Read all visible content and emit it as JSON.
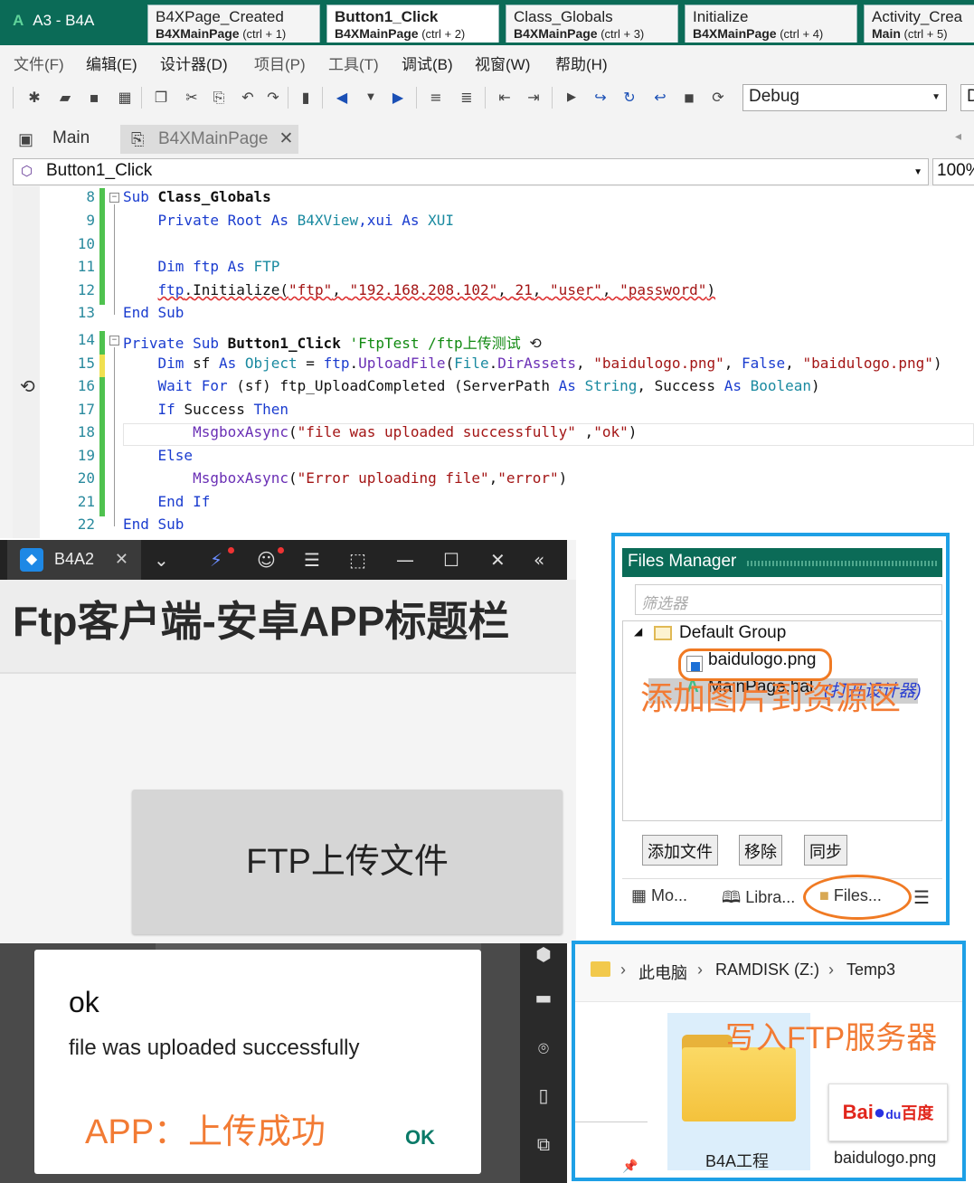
{
  "ide": {
    "app_title": "A3 - B4A",
    "doc_tabs": [
      {
        "title": "B4XPage_Created",
        "sub": "B4XMainPage",
        "shortcut": "(ctrl + 1)",
        "active": false
      },
      {
        "title": "Button1_Click",
        "sub": "B4XMainPage",
        "shortcut": "(ctrl + 2)",
        "active": true
      },
      {
        "title": "Class_Globals",
        "sub": "B4XMainPage",
        "shortcut": "(ctrl + 3)",
        "active": false
      },
      {
        "title": "Initialize",
        "sub": "B4XMainPage",
        "shortcut": "(ctrl + 4)",
        "active": false
      },
      {
        "title": "Activity_Crea",
        "sub": "Main",
        "shortcut": "(ctrl + 5)",
        "active": false
      }
    ],
    "menu": [
      "文件(F)",
      "编辑(E)",
      "设计器(D)",
      "项目(P)",
      "工具(T)",
      "调试(B)",
      "视窗(W)",
      "帮助(H)"
    ],
    "build_config": "Debug",
    "build_config2": "D",
    "module_tabs": [
      {
        "label": "Main",
        "icon": "designer-icon"
      },
      {
        "label": "B4XMainPage",
        "icon": "class-module-icon",
        "close": "✕"
      }
    ],
    "sub_selector": "Button1_Click",
    "zoom": "100%",
    "code_lines": [
      {
        "n": "8",
        "parts": [
          [
            "kw",
            "Sub "
          ],
          [
            "b",
            "Class_Globals"
          ]
        ]
      },
      {
        "n": "9",
        "parts": [
          [
            "t",
            "    "
          ],
          [
            "kw",
            "Private Root As "
          ],
          [
            "ty",
            "B4XView"
          ],
          [
            "kw",
            ",xui As "
          ],
          [
            "ty",
            "XUI"
          ]
        ]
      },
      {
        "n": "10",
        "parts": []
      },
      {
        "n": "11",
        "parts": [
          [
            "t",
            "    "
          ],
          [
            "kw",
            "Dim ftp As "
          ],
          [
            "ty",
            "FTP"
          ]
        ]
      },
      {
        "n": "12",
        "parts": [
          [
            "t",
            "    "
          ],
          [
            "kw",
            "ftp"
          ],
          [
            "t",
            "."
          ],
          [
            "t",
            "Initialize("
          ],
          [
            "st",
            "\"ftp\""
          ],
          [
            "t",
            ", "
          ],
          [
            "st",
            "\"192.168.208.102\""
          ],
          [
            "t",
            ", "
          ],
          [
            "st",
            "21"
          ],
          [
            "t",
            ", "
          ],
          [
            "st",
            "\"user\""
          ],
          [
            "t",
            ", "
          ],
          [
            "st",
            "\"password\""
          ],
          [
            "t",
            ")"
          ]
        ]
      },
      {
        "n": "13",
        "parts": [
          [
            "kw",
            "End Sub"
          ]
        ]
      },
      {
        "n": "14",
        "parts": [
          [
            "kw",
            "Private Sub "
          ],
          [
            "b",
            "Button1_Click"
          ],
          [
            "cm",
            " 'FtpTest /ftp上传测试"
          ]
        ]
      },
      {
        "n": "15",
        "parts": [
          [
            "t",
            "    "
          ],
          [
            "kw",
            "Dim "
          ],
          [
            "t",
            "sf "
          ],
          [
            "kw",
            "As "
          ],
          [
            "ty",
            "Object"
          ],
          [
            "t",
            " = "
          ],
          [
            "kw",
            "ftp"
          ],
          [
            "t",
            "."
          ],
          [
            "fn",
            "UploadFile"
          ],
          [
            "t",
            "("
          ],
          [
            "ty",
            "File"
          ],
          [
            "t",
            "."
          ],
          [
            "fn",
            "DirAssets"
          ],
          [
            "t",
            ", "
          ],
          [
            "st",
            "\"baidulogo.png\""
          ],
          [
            "t",
            ", "
          ],
          [
            "kw",
            "False"
          ],
          [
            "t",
            ", "
          ],
          [
            "st",
            "\"baidulogo.png\""
          ],
          [
            "t",
            ")"
          ]
        ]
      },
      {
        "n": "16",
        "parts": [
          [
            "t",
            "    "
          ],
          [
            "kw",
            "Wait For "
          ],
          [
            "t",
            "(sf) ftp_UploadCompleted (ServerPath "
          ],
          [
            "kw",
            "As "
          ],
          [
            "ty",
            "String"
          ],
          [
            "t",
            ", Success "
          ],
          [
            "kw",
            "As "
          ],
          [
            "ty",
            "Boolean"
          ],
          [
            "t",
            ")"
          ]
        ]
      },
      {
        "n": "17",
        "parts": [
          [
            "t",
            "    "
          ],
          [
            "kw",
            "If "
          ],
          [
            "t",
            "Success "
          ],
          [
            "kw",
            "Then"
          ]
        ]
      },
      {
        "n": "18",
        "parts": [
          [
            "t",
            "        "
          ],
          [
            "fn",
            "MsgboxAsync"
          ],
          [
            "t",
            "("
          ],
          [
            "st",
            "\"file was uploaded successfully\""
          ],
          [
            "t",
            " ,"
          ],
          [
            "st",
            "\"ok\""
          ],
          [
            "t",
            ")"
          ]
        ]
      },
      {
        "n": "19",
        "parts": [
          [
            "t",
            "    "
          ],
          [
            "kw",
            "Else"
          ]
        ]
      },
      {
        "n": "20",
        "parts": [
          [
            "t",
            "        "
          ],
          [
            "fn",
            "MsgboxAsync"
          ],
          [
            "t",
            "("
          ],
          [
            "st",
            "\"Error uploading file\""
          ],
          [
            "t",
            ","
          ],
          [
            "st",
            "\"error\""
          ],
          [
            "t",
            ")"
          ]
        ]
      },
      {
        "n": "21",
        "parts": [
          [
            "t",
            "    "
          ],
          [
            "kw",
            "End If"
          ]
        ]
      },
      {
        "n": "22",
        "parts": [
          [
            "kw",
            "End Sub"
          ]
        ]
      }
    ]
  },
  "phone": {
    "window_tab": "B4A2",
    "window_tab_close": "✕",
    "app_title": "Ftp客户端-安卓APP标题栏",
    "upload_button": "FTP上传文件"
  },
  "files_manager": {
    "title": "Files Manager",
    "filter_placeholder": "筛选器",
    "group": "Default Group",
    "files": [
      {
        "name": "baidulogo.png",
        "note": ""
      },
      {
        "name": "MainPage.bal",
        "note": "(打开设计器)"
      }
    ],
    "hint": "添加图片到资源区",
    "buttons": [
      "添加文件",
      "移除",
      "同步"
    ],
    "bottom_tabs": [
      "Mo...",
      "Libra...",
      "Files..."
    ]
  },
  "dialog": {
    "title": "ok",
    "message": "file was uploaded successfully",
    "ok_button": "OK",
    "note": "APP：上传成功"
  },
  "explorer": {
    "breadcrumb": [
      "此电脑",
      "RAMDISK (Z:)",
      "Temp3"
    ],
    "items": [
      {
        "name": "B4A工程",
        "type": "folder"
      },
      {
        "name": "baidulogo.png",
        "type": "image"
      }
    ],
    "baidu_logo_text": {
      "bai": "Bai",
      "du": "du",
      "cn": "百度"
    },
    "note": "写入FTP服务器"
  },
  "colors": {
    "title_bar": "#0b6b57",
    "annotation": "#f27b34",
    "highlight_border": "#1ea0e6",
    "keyword": "#1a3ccf",
    "type": "#1a8aa0",
    "string": "#a31515",
    "comment": "#118a11"
  }
}
